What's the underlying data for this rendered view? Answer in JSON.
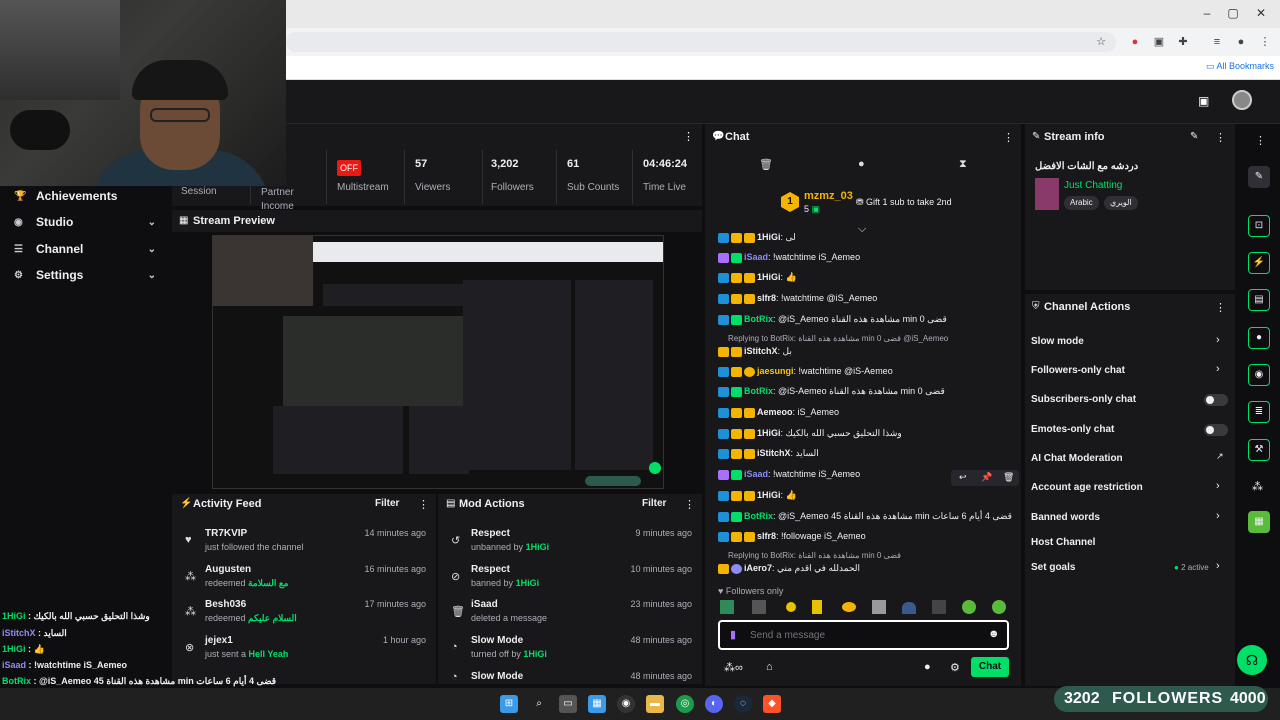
{
  "browser": {
    "bookmarks_label": "All Bookmarks"
  },
  "sidebar": {
    "items": [
      {
        "label": "Achievements",
        "icon": "trophy-icon"
      },
      {
        "label": "Studio",
        "icon": "camera-icon"
      },
      {
        "label": "Channel",
        "icon": "channel-icon"
      },
      {
        "label": "Settings",
        "icon": "gear-icon"
      }
    ]
  },
  "stats": {
    "session_label": "Session",
    "partner_label": "Partner Income",
    "off_badge": "OFF",
    "multistream_label": "Multistream",
    "viewers_value": "57",
    "viewers_label": "Viewers",
    "followers_value": "3,202",
    "followers_label": "Followers",
    "subs_value": "61",
    "subs_label": "Sub Counts",
    "time_value": "04:46:24",
    "time_label": "Time Live"
  },
  "preview": {
    "title": "Stream Preview"
  },
  "activity": {
    "title": "Activity Feed",
    "filter": "Filter",
    "items": [
      {
        "name": "TR7KVIP",
        "sub": "just followed the channel",
        "extra": "",
        "time": "14 minutes ago"
      },
      {
        "name": "Augusten",
        "sub": "redeemed",
        "extra": "مع السلامة",
        "time": "16 minutes ago"
      },
      {
        "name": "Besh036",
        "sub": "redeemed",
        "extra": "السلام عليكم",
        "time": "17 minutes ago"
      },
      {
        "name": "jejex1",
        "sub": "just sent a",
        "extra": "Hell Yeah",
        "time": "1 hour ago"
      }
    ]
  },
  "mod_actions": {
    "title": "Mod Actions",
    "filter": "Filter",
    "items": [
      {
        "name": "Respect",
        "sub": "unbanned by",
        "extra": "1HiGi",
        "time": "9 minutes ago"
      },
      {
        "name": "Respect",
        "sub": "banned by",
        "extra": "1HiGi",
        "time": "10 minutes ago"
      },
      {
        "name": "iSaad",
        "sub": "deleted a message",
        "extra": "",
        "time": "23 minutes ago"
      },
      {
        "name": "Slow Mode",
        "sub": "turned off by",
        "extra": "1HiGi",
        "time": "48 minutes ago"
      },
      {
        "name": "Slow Mode",
        "sub": "",
        "extra": "",
        "time": "48 minutes ago"
      }
    ]
  },
  "overlay_chat": [
    {
      "user": "1HiGi",
      "msg": "وشذا التحليق حسبي الله بالكيك"
    },
    {
      "user": "iStitchX",
      "msg": "السايد"
    },
    {
      "user": "1HiGi",
      "msg": "👍"
    },
    {
      "user": "iSaad",
      "msg": "!watchtime iS_Aemeo"
    },
    {
      "user": "BotRix",
      "msg": "@iS_Aemeo 45 مشاهدة هذه القناة min قضى 4 أيام 6 ساعات"
    },
    {
      "user": "iAero7",
      "msg": "!followage iS_Aemeo"
    }
  ],
  "chat": {
    "title": "Chat",
    "top_gifter": {
      "rank": "1",
      "name": "mzmz_03",
      "count": "5"
    },
    "gift_text": "Gift 1 sub to take 2nd",
    "messages": [
      {
        "user": "1HiGi",
        "msg": "لى",
        "color": "#ffffff"
      },
      {
        "user": "iSaad",
        "msg": "!watchtime iS_Aemeo",
        "color": "#8c8cf5"
      },
      {
        "user": "1HiGi",
        "msg": "👍",
        "color": "#ffffff"
      },
      {
        "user": "slfr8",
        "msg": "!watchtime @iS_Aemeo",
        "color": "#ffffff"
      },
      {
        "user": "BotRix",
        "msg": "@iS_Aemeo مشاهدة هذه القناة min قضى 0",
        "color": "#00e068"
      },
      {
        "user": "iStitchX",
        "msg": "بل",
        "color": "#ffffff"
      },
      {
        "user": "jaesungi",
        "msg": "!watchtime @iS-Aemeo",
        "color": "#f5c518"
      },
      {
        "user": "BotRix",
        "msg": "@iS-Aemeo مشاهدة هذه القناة min قضى 0",
        "color": "#00e068"
      },
      {
        "user": "Aemeoo",
        "msg": "iS_Aemeo",
        "color": "#ffffff"
      },
      {
        "user": "1HiGi",
        "msg": "وشذا التحليق حسبي الله بالكيك",
        "color": "#ffffff"
      },
      {
        "user": "iStitchX",
        "msg": "السايد",
        "color": "#ffffff"
      },
      {
        "user": "iSaad",
        "msg": "!watchtime iS_Aemeo",
        "color": "#8c8cf5"
      },
      {
        "user": "1HiGi",
        "msg": "👍",
        "color": "#ffffff"
      },
      {
        "user": "BotRix",
        "msg": "@iS_Aemeo 45 مشاهدة هذه القناة min قضى 4 أيام 6 ساعات",
        "color": "#00e068"
      },
      {
        "user": "slfr8",
        "msg": "!followage iS_Aemeo",
        "color": "#ffffff"
      },
      {
        "user": "iAero7",
        "msg": "الحمدلله في اقدم مني",
        "color": "#ffffff"
      }
    ],
    "replies": [
      "Replying to BotRix: مشاهدة هذه القناة min قضى 0 @iS_Aemeo",
      "Replying to BotRix: مشاهدة هذه القناة min قضى 0",
      "Replying to BotRix: مشاهدة هذه القناة min قضى 0"
    ],
    "followers_only": "Followers only",
    "input_placeholder": "Send a message",
    "send_label": "Chat"
  },
  "stream_info": {
    "title": "Stream info",
    "stream_title": "دردشه مع الشات الافضل",
    "category": "Just Chatting",
    "tags": [
      "Arabic",
      "الويري"
    ]
  },
  "channel_actions": {
    "title": "Channel Actions",
    "items": [
      {
        "label": "Slow mode",
        "kind": "chevron"
      },
      {
        "label": "Followers-only chat",
        "kind": "chevron"
      },
      {
        "label": "Subscribers-only chat",
        "kind": "toggle"
      },
      {
        "label": "Emotes-only chat",
        "kind": "toggle"
      },
      {
        "label": "AI Chat Moderation",
        "kind": "external"
      },
      {
        "label": "Account age restriction",
        "kind": "chevron"
      },
      {
        "label": "Banned words",
        "kind": "chevron"
      },
      {
        "label": "Host Channel",
        "kind": "none"
      },
      {
        "label": "Set goals",
        "kind": "chevron"
      }
    ],
    "goals_active": "2 active"
  },
  "followers_bar": {
    "left": "3202",
    "label": "FOLLOWERS",
    "right": "4000"
  },
  "colors": {
    "accent": "#00e068",
    "panel": "#18181b",
    "background": "#0e0e10",
    "off": "#e91916"
  }
}
